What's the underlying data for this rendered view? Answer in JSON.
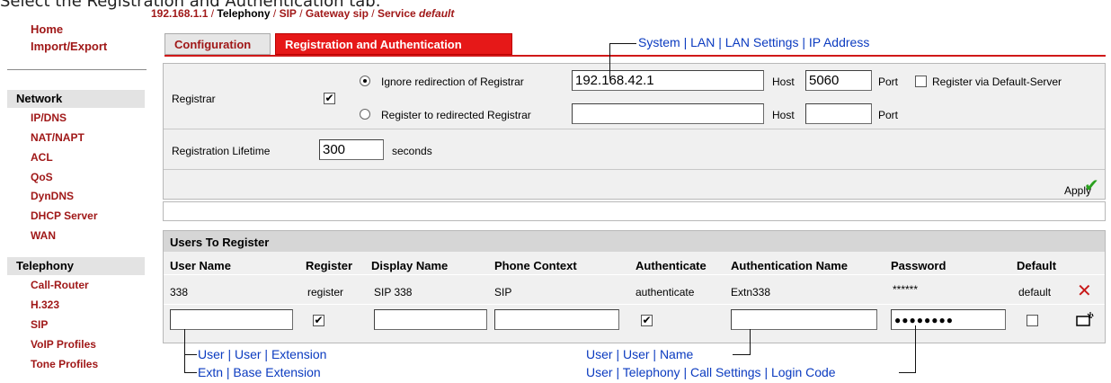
{
  "caption": "Select the Registration and Authentication tab.",
  "sidebar": {
    "home": "Home",
    "import_export": "Import/Export",
    "network_head": "Network",
    "network_items": [
      "IP/DNS",
      "NAT/NAPT",
      "ACL",
      "QoS",
      "DynDNS",
      "DHCP Server",
      "WAN"
    ],
    "telephony_head": "Telephony",
    "telephony_items": [
      "Call-Router",
      "H.323",
      "SIP",
      "VoIP Profiles",
      "Tone Profiles"
    ]
  },
  "breadcrumb": {
    "ip": "192.168.1.1",
    "sep": " / ",
    "current": "Telephony",
    "sip": "SIP",
    "gateway": "Gateway sip",
    "service_prefix": "Service ",
    "service_name": "default"
  },
  "tabs": {
    "configuration": "Configuration",
    "registration": "Registration and Authentication"
  },
  "registrar": {
    "label": "Registrar",
    "enabled": true,
    "ignore_label": "Ignore redirection of Registrar",
    "register_label": "Register to redirected Registrar",
    "host_value": "192.168.42.1",
    "host_label": "Host",
    "port_value": "5060",
    "port_label": "Port",
    "default_server_label": "Register via Default-Server",
    "redirected_host_value": "",
    "redirected_port_value": ""
  },
  "lifetime": {
    "label": "Registration Lifetime",
    "value": "300",
    "unit": "seconds"
  },
  "apply_label": "Apply",
  "users": {
    "title": "Users To Register",
    "columns": [
      "User Name",
      "Register",
      "Display Name",
      "Phone Context",
      "Authenticate",
      "Authentication Name",
      "Password",
      "Default"
    ],
    "row": {
      "user_name": "338",
      "register": "register",
      "display_name": "SIP 338",
      "phone_context": "SIP",
      "authenticate": "authenticate",
      "auth_name": "Extn338",
      "password": "******",
      "default": "default"
    },
    "new_password_mask": "●●●●●●●●"
  },
  "annotations": {
    "system": "System | LAN | LAN Settings | IP Address",
    "user_ext": "User | User | Extension",
    "extn_base": "Extn | Base Extension",
    "user_name": "User | User | Name",
    "login_code": "User | Telephony | Call Settings | Login Code"
  },
  "colors": {
    "accent": "#e61818",
    "link": "#a01818",
    "annotation": "#0b3bc0",
    "panel_bg": "#f0f0f0"
  }
}
